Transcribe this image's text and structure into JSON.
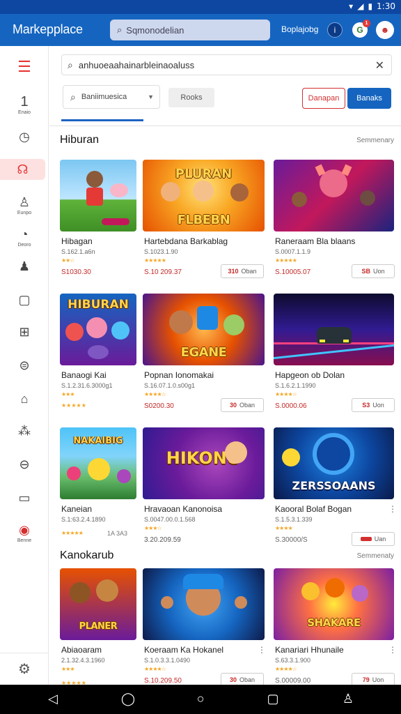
{
  "status_bar": {
    "time": "1:30"
  },
  "app_bar": {
    "title": "Markepplace",
    "search_placeholder": "Sqmonodelian",
    "lang_label": "Boplajobg"
  },
  "sidebar": {
    "items": [
      {
        "icon": "menu-icon",
        "caption": ""
      },
      {
        "icon": "number-one-icon",
        "caption": "Enaio"
      },
      {
        "icon": "clock-icon",
        "caption": ""
      },
      {
        "icon": "headset-icon",
        "caption": ""
      },
      {
        "icon": "user-search-icon",
        "caption": "Eunpo"
      },
      {
        "icon": "timer-icon",
        "caption": "Deoro"
      },
      {
        "icon": "person-icon",
        "caption": ""
      },
      {
        "icon": "tablet-icon",
        "caption": ""
      },
      {
        "icon": "grid-icon",
        "caption": ""
      },
      {
        "icon": "coin-icon",
        "caption": ""
      },
      {
        "icon": "bag-icon",
        "caption": ""
      },
      {
        "icon": "network-icon",
        "caption": ""
      },
      {
        "icon": "minus-circle-icon",
        "caption": ""
      },
      {
        "icon": "folder-icon",
        "caption": ""
      },
      {
        "icon": "alert-icon",
        "caption": "Benne"
      }
    ]
  },
  "main": {
    "search_value": "anhuoeaahainarbleinaoaluss",
    "filter_select": "Baniimuesica",
    "filter_tag": "Rooks",
    "btn_outline": "Danapan",
    "btn_fill": "Banaks",
    "sections": [
      {
        "title": "Hiburan",
        "more": "Semmenary",
        "cards": [
          {
            "name": "Hibagan",
            "meta": "S.162.1.a6n",
            "stars": "★★☆",
            "price": "S1030.30",
            "badge_num": "",
            "badge_text": "",
            "thumb_text": ""
          },
          {
            "name": "Hartebdana Barkablag",
            "meta": "S.1023.1.90",
            "stars": "★★★★★",
            "price": "S.10 209.37",
            "badge_num": "310",
            "badge_text": "Oban",
            "thumb_text": "FLBEBN"
          },
          {
            "name": "Raneraam Bla blaans",
            "meta": "S.0007.1.1.9",
            "stars": "★★★★★",
            "price": "S.10005.07",
            "badge_num": "SB",
            "badge_text": "Uon",
            "thumb_text": ""
          },
          {
            "name": "Banaogi Kai",
            "meta": "S.1.2.31.6.3000g1",
            "stars": "★★★",
            "price": "★★★★★",
            "badge_num": "",
            "badge_text": "",
            "thumb_text": "HIBURAN"
          },
          {
            "name": "Popnan Ionomakai",
            "meta": "S.16.07.1.0.s00g1",
            "stars": "★★★★☆",
            "price": "S0200.30",
            "badge_num": "30",
            "badge_text": "Oban",
            "thumb_text": "EGANE"
          },
          {
            "name": "Hapgeon ob Dolan",
            "meta": "S.1.6.2.1.1990",
            "stars": "★★★★☆",
            "price": "S.0000.06",
            "badge_num": "S3",
            "badge_text": "Uon",
            "thumb_text": ""
          },
          {
            "name": "Kaneian",
            "meta": "S.1:63.2.4.1890",
            "stars": "★★★★★",
            "price": "1A 3A3",
            "badge_num": "",
            "badge_text": "",
            "thumb_text": "NAKAIBIG"
          },
          {
            "name": "Hravaoan Kanonoisa",
            "meta": "S.0047.00.0.1.568",
            "stars": "★★★☆",
            "price": "3.20.209.59",
            "badge_num": "",
            "badge_text": "",
            "thumb_text": "HIKONO"
          },
          {
            "name": "Kaooral Bolaf Bogan",
            "meta": "S.1.5.3.1.339",
            "stars": "★★★★",
            "price": "S.30000/S",
            "badge_num": "",
            "badge_text": "Uan",
            "thumb_text": "ZERSSOAANS"
          }
        ]
      },
      {
        "title": "Kanokarub",
        "more": "Semmenaty",
        "cards": [
          {
            "name": "Abiaoaram",
            "meta": "2.1.32.4.3.1960",
            "stars": "★★★",
            "price": "★★★★★",
            "badge_num": "",
            "badge_text": "",
            "thumb_text": "PLANER"
          },
          {
            "name": "Koeraam Ka Hokanel",
            "meta": "S.1.0.3.3.1.0490",
            "stars": "★★★★☆",
            "price": "S.10.209.50",
            "badge_num": "30",
            "badge_text": "Oban",
            "thumb_text": ""
          },
          {
            "name": "Kanariari Hhunaile",
            "meta": "S.63.3.1.900",
            "stars": "★★★★☆",
            "price": "S.00009.00",
            "badge_num": "79",
            "badge_text": "Uon",
            "thumb_text": "SHAKARE"
          }
        ]
      }
    ]
  },
  "colors": {
    "brand": "#1565c0",
    "accent": "#e53935",
    "star": "#f5a623"
  }
}
